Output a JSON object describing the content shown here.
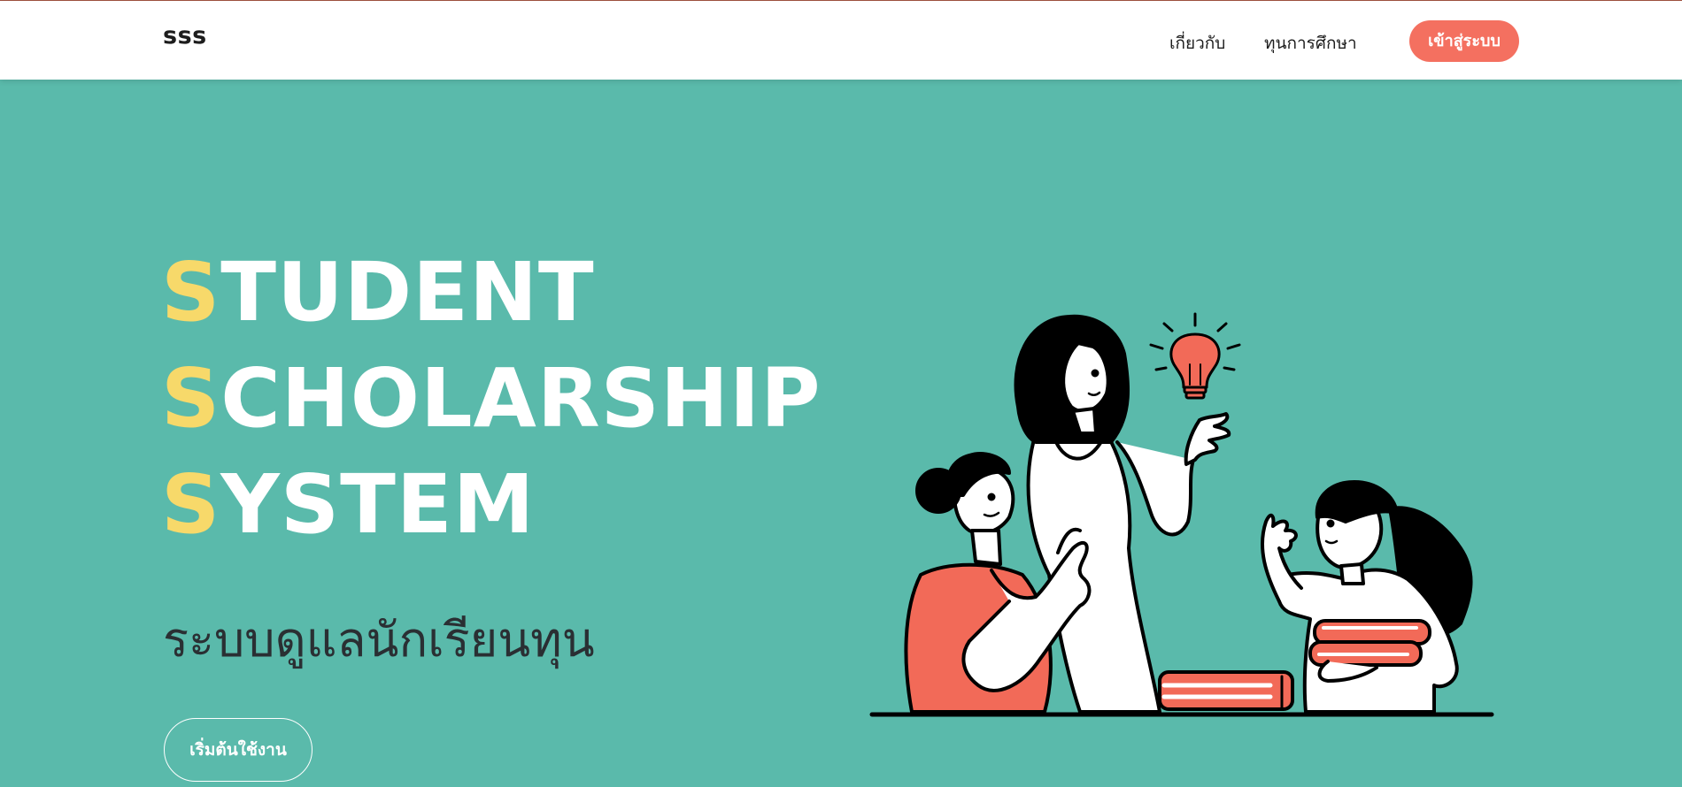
{
  "nav": {
    "brand": "sss",
    "links": [
      "เกี่ยวกับ",
      "ทุนการศึกษา"
    ],
    "login_label": "เข้าสู่ระบบ"
  },
  "hero": {
    "lines": [
      {
        "initial": "S",
        "rest": "TUDENT"
      },
      {
        "initial": "S",
        "rest": "CHOLARSHIP"
      },
      {
        "initial": "S",
        "rest": "YSTEM"
      }
    ],
    "subtitle": "ระบบดูแลนักเรียนทุน",
    "cta_label": "เริ่มต้นใช้งาน"
  },
  "colors": {
    "background": "#5abaab",
    "accent": "#f7d96a",
    "button": "#f47060"
  }
}
